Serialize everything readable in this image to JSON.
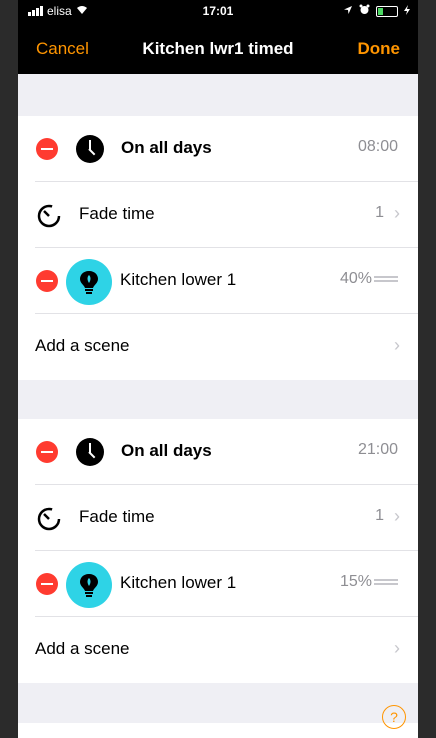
{
  "status": {
    "carrier": "elisa",
    "time": "17:01"
  },
  "nav": {
    "cancel": "Cancel",
    "title": "Kitchen lwr1 timed",
    "done": "Done"
  },
  "sections": [
    {
      "schedule": {
        "label": "On all days",
        "time": "08:00"
      },
      "fade": {
        "label": "Fade time",
        "value": "1"
      },
      "device": {
        "label": "Kitchen lower 1",
        "level": "40%"
      },
      "add": {
        "label": "Add a scene"
      }
    },
    {
      "schedule": {
        "label": "On all days",
        "time": "21:00"
      },
      "fade": {
        "label": "Fade time",
        "value": "1"
      },
      "device": {
        "label": "Kitchen lower 1",
        "level": "15%"
      },
      "add": {
        "label": "Add a scene"
      }
    }
  ],
  "help": "?",
  "icons": {
    "remove": "minus-circle-icon",
    "clock": "clock-icon",
    "timer": "timer-icon",
    "bulb": "lightbulb-icon",
    "chevron": "chevron-right-icon",
    "drag": "reorder-handle-icon"
  },
  "colors": {
    "accent": "#ff9500",
    "delete": "#ff3b30",
    "device": "#2ed3e6"
  }
}
